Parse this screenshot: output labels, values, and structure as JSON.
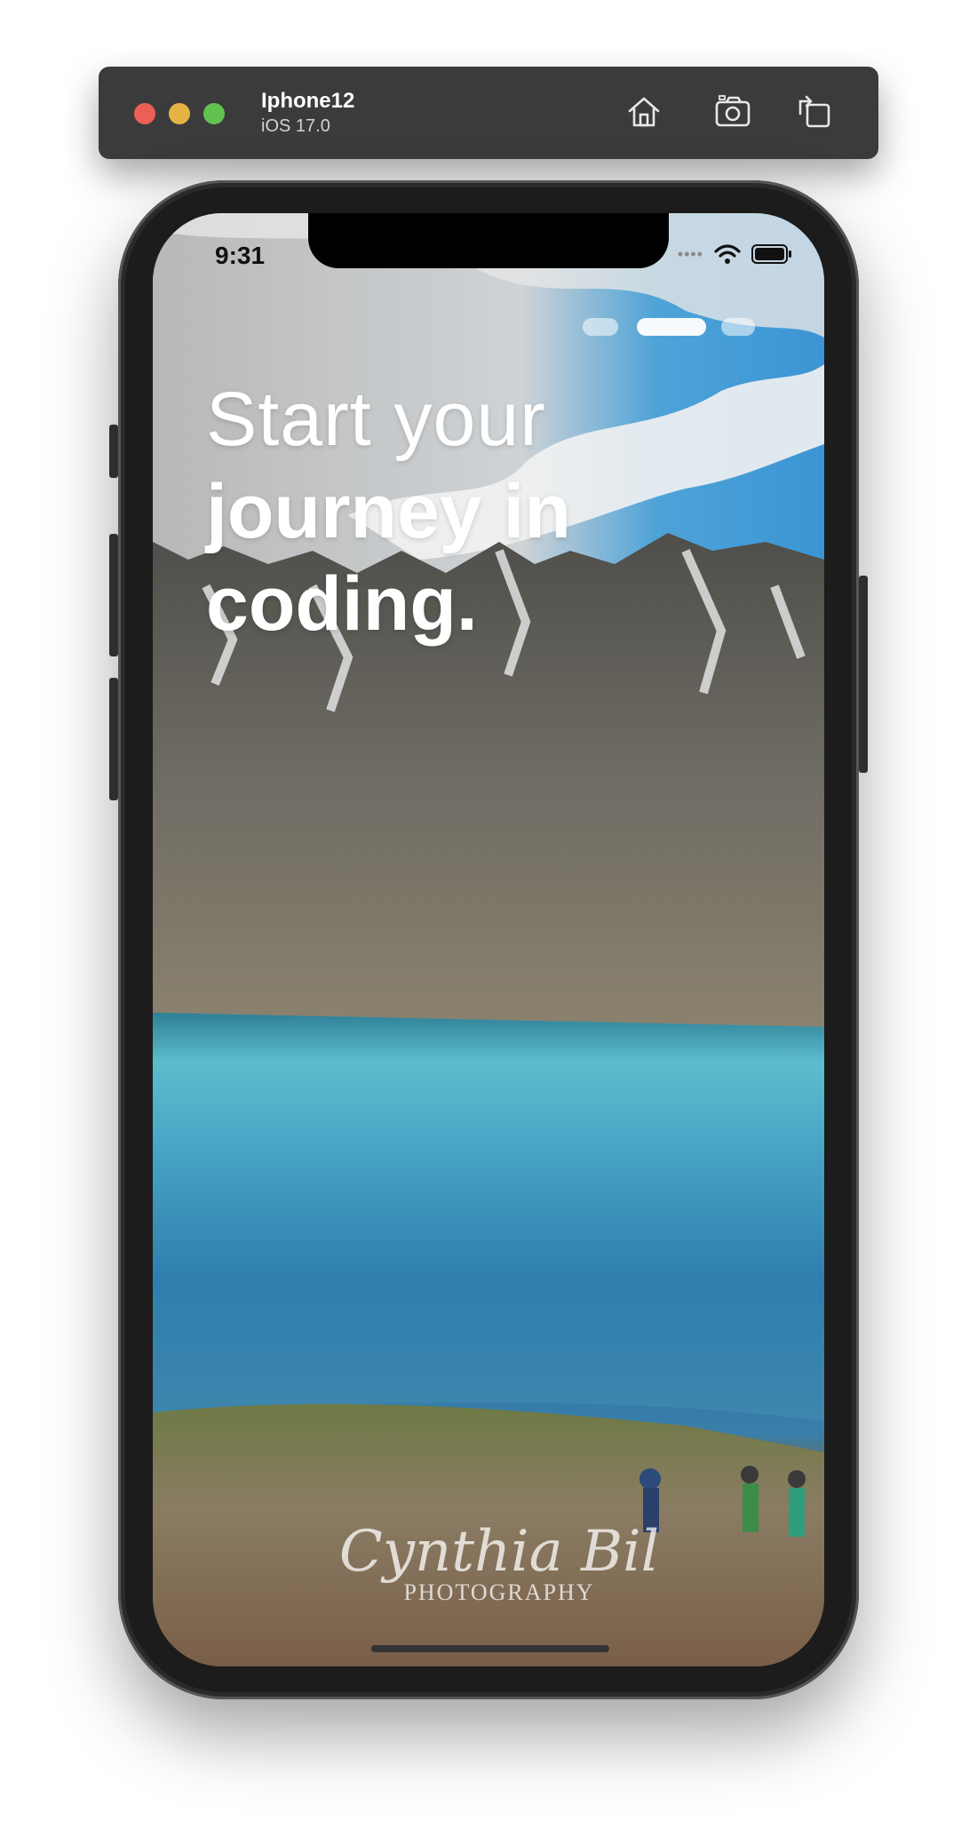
{
  "simulator": {
    "device_name": "Iphone12",
    "os_version": "iOS 17.0",
    "toolbar_icons": [
      "home-icon",
      "screenshot-icon",
      "rotate-icon"
    ]
  },
  "status_bar": {
    "time": "9:31",
    "icons": [
      "wifi-icon",
      "battery-icon"
    ]
  },
  "onboarding": {
    "page_indicator": {
      "pages": 3,
      "current": 2
    },
    "headline_light": "Start your",
    "headline_bold_1": "journey in",
    "headline_bold_2": "coding."
  },
  "photo_watermark": {
    "signature": "Cynthia Bil",
    "label": "PHOTOGRAPHY"
  },
  "colors": {
    "close": "#ec5f57",
    "minimize": "#e5b343",
    "zoom": "#63c150",
    "sky": "#3f9ed8",
    "lake": "#3f9ec0"
  }
}
